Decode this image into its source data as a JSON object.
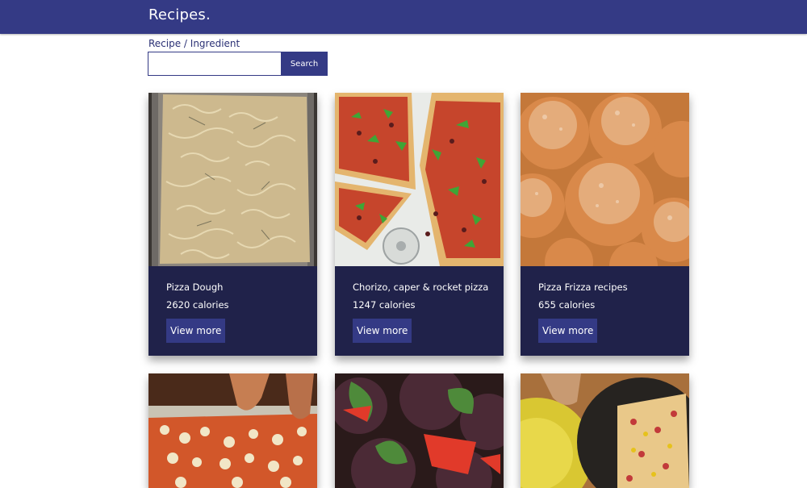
{
  "header": {
    "brand": "Recipes."
  },
  "search": {
    "label": "Recipe / Ingredient",
    "value": "",
    "placeholder": "",
    "button_label": "Search"
  },
  "cards": [
    {
      "title": "Pizza Dough",
      "calories": "2620 calories",
      "button_label": "View more"
    },
    {
      "title": "Chorizo, caper & rocket pizza",
      "calories": "1247 calories",
      "button_label": "View more"
    },
    {
      "title": "Pizza Frizza recipes",
      "calories": "655 calories",
      "button_label": "View more"
    },
    {
      "title": "",
      "calories": "",
      "button_label": ""
    },
    {
      "title": "",
      "calories": "",
      "button_label": ""
    },
    {
      "title": "",
      "calories": "",
      "button_label": ""
    }
  ],
  "colors": {
    "navbar": "#343a85",
    "card_background": "#20224a",
    "button": "#343a85"
  }
}
